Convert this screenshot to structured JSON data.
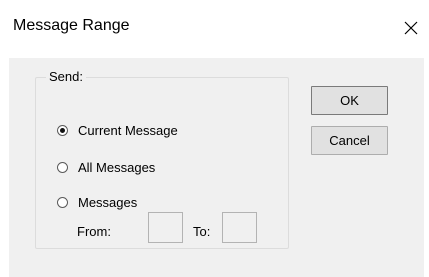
{
  "window": {
    "title": "Message Range",
    "close_icon": "close-icon"
  },
  "send_group": {
    "label": "Send:",
    "options": [
      {
        "label": "Current Message",
        "checked": true
      },
      {
        "label": "All Messages",
        "checked": false
      },
      {
        "label": "Messages",
        "checked": false
      }
    ],
    "from_label": "From:",
    "from_value": "",
    "to_label": "To:",
    "to_value": ""
  },
  "buttons": {
    "ok_label": "OK",
    "cancel_label": "Cancel"
  }
}
